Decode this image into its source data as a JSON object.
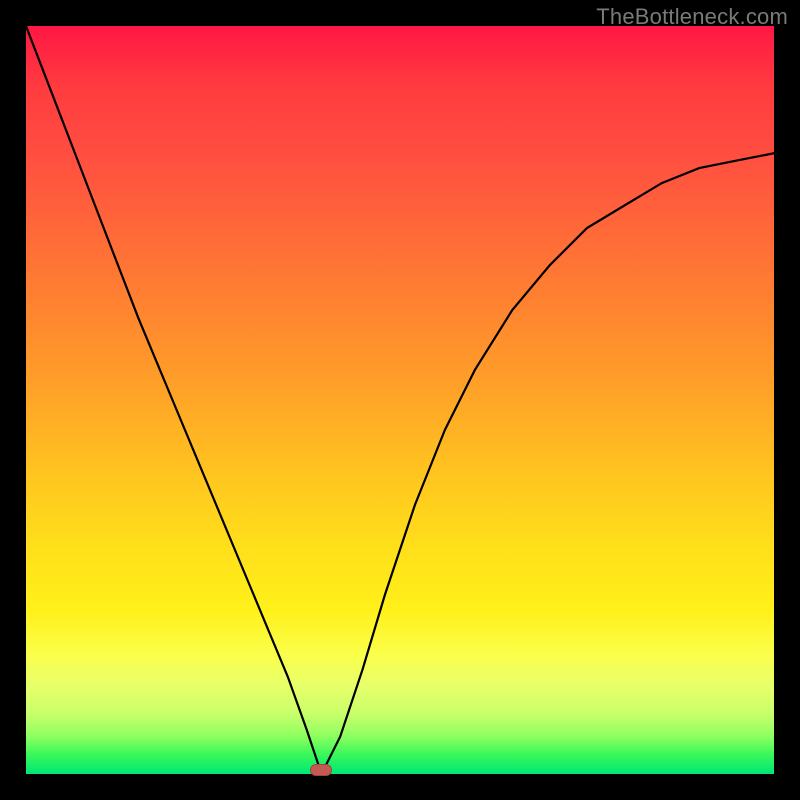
{
  "watermark": "TheBottleneck.com",
  "marker": {
    "x_norm": 0.395,
    "y_norm": 0.997
  },
  "chart_data": {
    "type": "line",
    "title": "",
    "xlabel": "",
    "ylabel": "",
    "xlim": [
      0,
      1
    ],
    "ylim": [
      0,
      1
    ],
    "background_gradient_note": "color encodes bottleneck severity: red (top) = high, green (bottom) = low",
    "series": [
      {
        "name": "bottleneck-curve",
        "x": [
          0.0,
          0.05,
          0.1,
          0.15,
          0.2,
          0.25,
          0.3,
          0.325,
          0.35,
          0.375,
          0.395,
          0.42,
          0.45,
          0.48,
          0.52,
          0.56,
          0.6,
          0.65,
          0.7,
          0.75,
          0.8,
          0.85,
          0.9,
          0.95,
          1.0
        ],
        "y": [
          1.0,
          0.87,
          0.74,
          0.61,
          0.49,
          0.37,
          0.25,
          0.19,
          0.13,
          0.06,
          0.0,
          0.05,
          0.14,
          0.24,
          0.36,
          0.46,
          0.54,
          0.62,
          0.68,
          0.73,
          0.76,
          0.79,
          0.81,
          0.82,
          0.83
        ]
      }
    ],
    "annotations": [
      {
        "name": "optimal-point",
        "x": 0.395,
        "y": 0.0
      }
    ]
  }
}
